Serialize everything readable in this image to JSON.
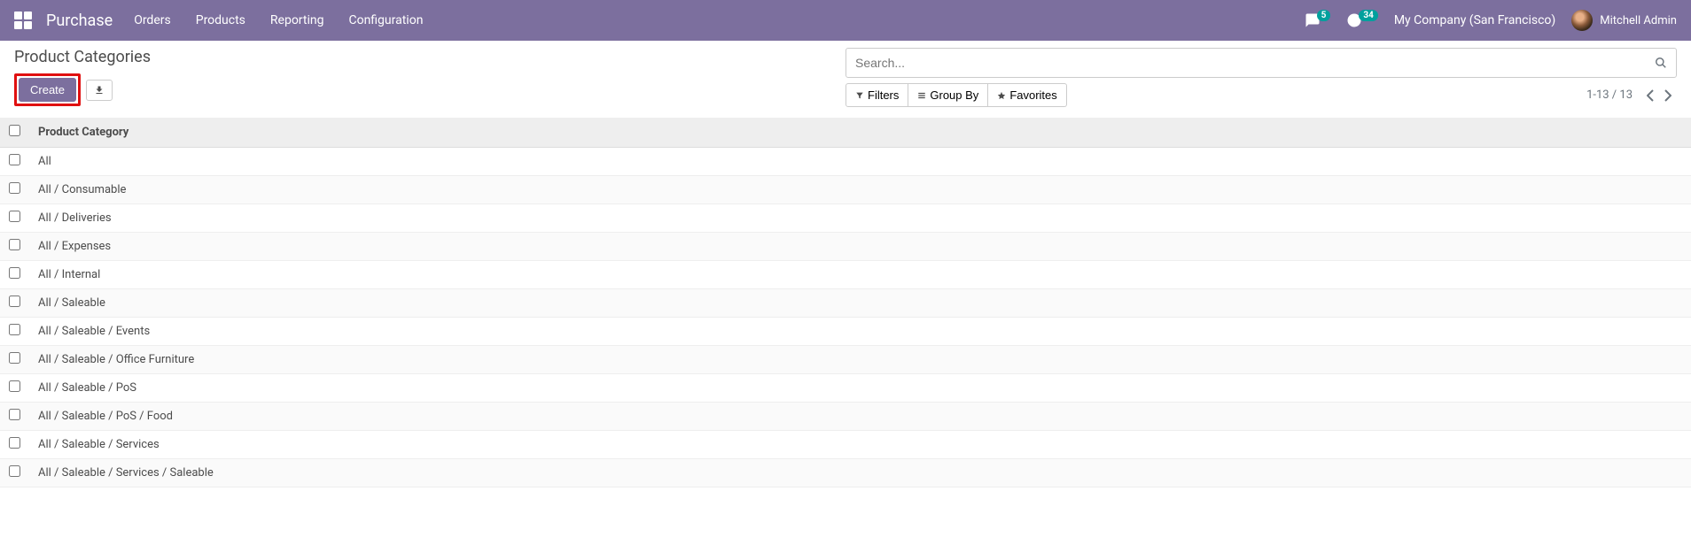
{
  "navbar": {
    "brand": "Purchase",
    "menu": [
      "Orders",
      "Products",
      "Reporting",
      "Configuration"
    ],
    "chat_badge": "5",
    "activity_badge": "34",
    "company": "My Company (San Francisco)",
    "user": "Mitchell Admin"
  },
  "breadcrumb": "Product Categories",
  "buttons": {
    "create": "Create"
  },
  "search": {
    "placeholder": "Search..."
  },
  "toolbar": {
    "filters": "Filters",
    "groupby": "Group By",
    "favorites": "Favorites"
  },
  "pager": "1-13 / 13",
  "table": {
    "header": "Product Category",
    "rows": [
      "All",
      "All / Consumable",
      "All / Deliveries",
      "All / Expenses",
      "All / Internal",
      "All / Saleable",
      "All / Saleable / Events",
      "All / Saleable / Office Furniture",
      "All / Saleable / PoS",
      "All / Saleable / PoS / Food",
      "All / Saleable / Services",
      "All / Saleable / Services / Saleable"
    ]
  }
}
